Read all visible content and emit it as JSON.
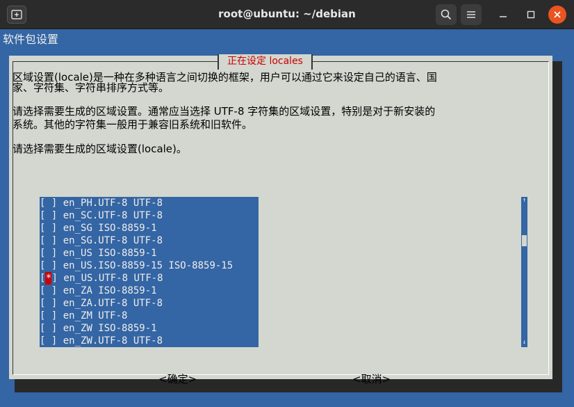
{
  "window": {
    "title": "root@ubuntu: ~/debian",
    "colors": {
      "close": "#e95420",
      "titlebar": "#2b2b2b"
    }
  },
  "terminal": {
    "backtitle": "软件包设置",
    "dialog": {
      "title": "正在设定 locales",
      "para1_line1": "区域设置(locale)是一种在多种语言之间切换的框架，用户可以通过它来设定自己的语言、国",
      "para1_line2": "家、字符集、字符串排序方式等。",
      "para2_line1": "请选择需要生成的区域设置。通常应当选择 UTF-8 字符集的区域设置，特别是对于新安装的",
      "para2_line2": "系统。其他的字符集一般用于兼容旧系统和旧软件。",
      "para3": "请选择需要生成的区域设置(locale)。",
      "items": [
        {
          "checked": false,
          "label": "en_PH.UTF-8 UTF-8"
        },
        {
          "checked": false,
          "label": "en_SC.UTF-8 UTF-8"
        },
        {
          "checked": false,
          "label": "en_SG ISO-8859-1"
        },
        {
          "checked": false,
          "label": "en_SG.UTF-8 UTF-8"
        },
        {
          "checked": false,
          "label": "en_US ISO-8859-1"
        },
        {
          "checked": false,
          "label": "en_US.ISO-8859-15 ISO-8859-15"
        },
        {
          "checked": true,
          "label": "en_US.UTF-8 UTF-8"
        },
        {
          "checked": false,
          "label": "en_ZA ISO-8859-1"
        },
        {
          "checked": false,
          "label": "en_ZA.UTF-8 UTF-8"
        },
        {
          "checked": false,
          "label": "en_ZM UTF-8"
        },
        {
          "checked": false,
          "label": "en_ZW ISO-8859-1"
        },
        {
          "checked": false,
          "label": "en_ZW.UTF-8 UTF-8"
        }
      ],
      "ok_label": "<确定>",
      "cancel_label": "<取消>"
    },
    "colors": {
      "background": "#3465a4",
      "dialog": "#d3d7cf",
      "title": "#cc0000"
    }
  },
  "icons": [
    "new-tab-icon",
    "search-icon",
    "hamburger-menu-icon",
    "minimize-icon",
    "maximize-icon",
    "close-icon"
  ]
}
